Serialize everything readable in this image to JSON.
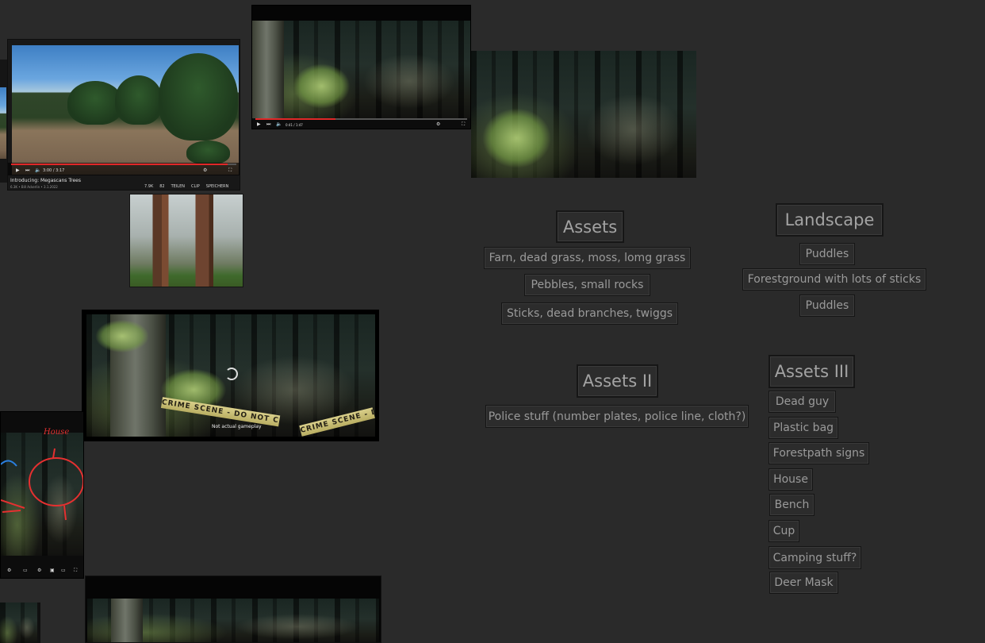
{
  "colors": {
    "board_background": "#2a2a2a",
    "note_background": "#2c2c2c",
    "note_text": "#9a9a9a",
    "note_border": "#151515",
    "video_progress": "#e02828",
    "annotation_red": "#e53030",
    "annotation_blue": "#2a7fe0"
  },
  "images": {
    "video_trees": {
      "time": "3:00 / 3:17",
      "title": "Introducing: Megascans Trees",
      "meta": "6.3K  •  Bill Ackerlin  •  3.1.2022",
      "actions": [
        "7.9K",
        "82",
        "TEILEN",
        "CLIP",
        "SPEICHERN"
      ]
    },
    "video_forest": {
      "time": "0:41 / 1:47"
    },
    "crime_scene": {
      "tape_text": "CRIME SCENE - DO NOT CROSS",
      "tape_text_2": "CRIME SCENE - DO",
      "subtitle": "Not actual gameplay"
    },
    "annotated": {
      "label": "House"
    }
  },
  "notes": {
    "assets": {
      "heading": "Assets",
      "items": [
        "Farn, dead grass, moss, lomg grass",
        "Pebbles, small rocks",
        "Sticks, dead branches, twiggs"
      ]
    },
    "landscape": {
      "heading": "Landscape",
      "items": [
        "Puddles",
        "Forestground with lots of sticks",
        "Puddles"
      ]
    },
    "assets_ii": {
      "heading": "Assets II",
      "items": [
        "Police stuff (number plates, police line, cloth?)"
      ]
    },
    "assets_iii": {
      "heading": "Assets III",
      "items": [
        "Dead guy",
        "Plastic bag",
        "Forestpath signs",
        "House",
        "Bench",
        "Cup",
        "Camping stuff?",
        "Deer Mask"
      ]
    }
  }
}
